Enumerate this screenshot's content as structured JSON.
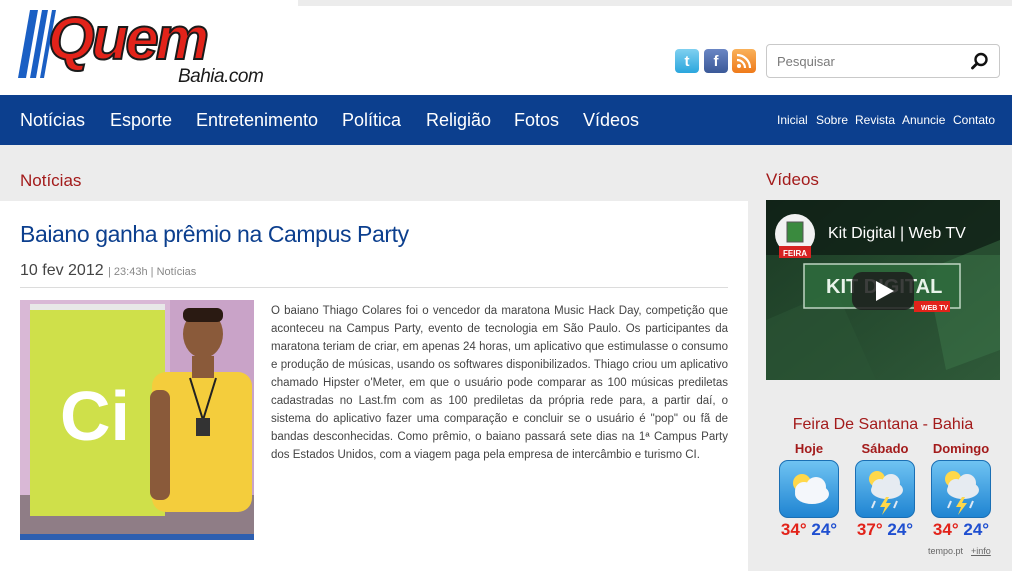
{
  "header": {
    "logo_word": "Quem",
    "logo_sub": "Bahia.com",
    "social": {
      "twitter": "t",
      "facebook": "f"
    },
    "search_placeholder": "Pesquisar"
  },
  "nav": {
    "main": [
      "Notícias",
      "Esporte",
      "Entretenimento",
      "Política",
      "Religião",
      "Fotos",
      "Vídeos"
    ],
    "secondary": [
      "Inicial",
      "Sobre",
      "Revista",
      "Anuncie",
      "Contato"
    ]
  },
  "article": {
    "section": "Notícias",
    "headline": "Baiano ganha prêmio na Campus Party",
    "date": "10 fev 2012",
    "time": "23:43h",
    "category": "Notícias",
    "photo_sign": "Ci",
    "body": "O baiano Thiago Colares foi o vencedor da maratona Music Hack Day, competição que aconteceu na Campus Party, evento de tecnologia em São Paulo. Os participantes da maratona teriam de criar, em apenas 24 horas, um aplicativo que estimulasse o consumo e produção de músicas, usando os softwares disponibilizados. Thiago criou um aplicativo chamado Hipster o'Meter, em que o usuário pode comparar as 100 músicas prediletas cadastradas no Last.fm com as 100 prediletas da própria rede para, a partir daí, o sistema do aplicativo fazer uma comparação e concluir se o usuário é \"pop\" ou fã de bandas desconhecidas. Como prêmio, o baiano passará sete dias na 1ª Campus Party dos Estados Unidos, com a viagem paga pela empresa de intercâmbio e turismo CI."
  },
  "sidebar": {
    "videos_title": "Vídeos",
    "video": {
      "title": "Kit Digital | Web TV",
      "channel_badge": "FEIRA",
      "screen_text": "KIT DIGITAL",
      "screen_tag": "WEB TV"
    },
    "weather": {
      "location": "Feira De Santana - Bahia",
      "days": [
        {
          "day": "Hoje",
          "max": "34°",
          "min": "24°",
          "icon": "cloudy-sun-icon"
        },
        {
          "day": "Sábado",
          "max": "37°",
          "min": "24°",
          "icon": "storm-sun-icon"
        },
        {
          "day": "Domingo",
          "max": "34°",
          "min": "24°",
          "icon": "storm-sun-icon"
        }
      ],
      "source": "tempo.pt",
      "more": "+info"
    }
  },
  "colors": {
    "brand_red": "#e2231a",
    "nav_blue": "#0c3f8e",
    "section_red": "#a31b1b"
  }
}
